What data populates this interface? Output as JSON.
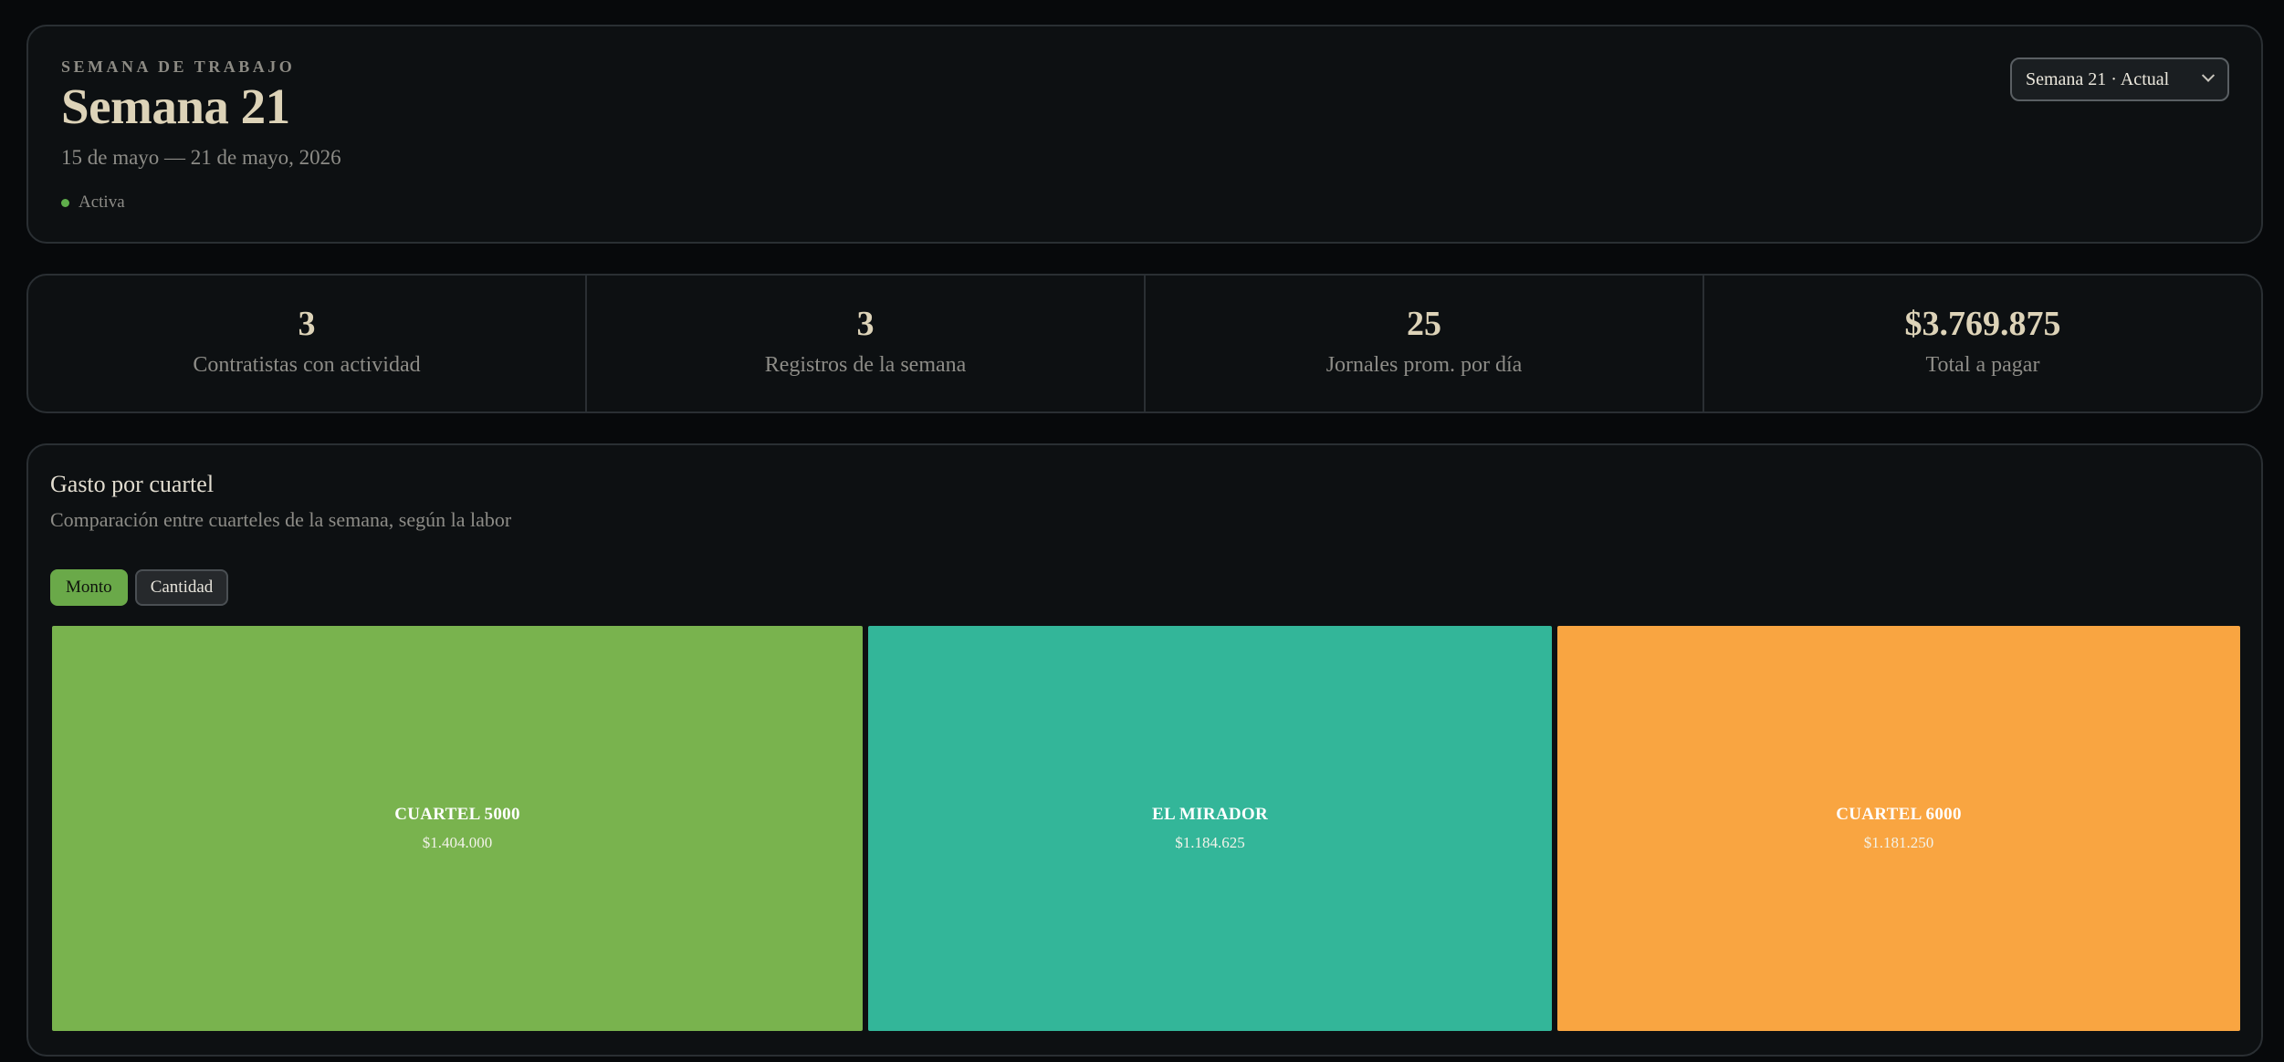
{
  "header": {
    "eyebrow": "SEMANA DE TRABAJO",
    "title": "Semana 21",
    "date_range": "15 de mayo — 21 de mayo, 2026",
    "status": "Activa",
    "status_color": "#5fae4b",
    "week_select": {
      "selected": "Semana 21 · Actual",
      "icon": "chevron-down-icon"
    }
  },
  "stats": [
    {
      "value": "3",
      "label": "Contratistas con actividad"
    },
    {
      "value": "3",
      "label": "Registros de la semana"
    },
    {
      "value": "25",
      "label": "Jornales prom. por día"
    },
    {
      "value": "$3.769.875",
      "label": "Total a pagar"
    }
  ],
  "spend": {
    "title": "Gasto por cuartel",
    "subtitle": "Comparación entre cuarteles de la semana, según la labor",
    "toggles": [
      {
        "label": "Monto",
        "active": true
      },
      {
        "label": "Cantidad",
        "active": false
      }
    ],
    "accent_color": "#6aa949"
  },
  "chart_data": {
    "type": "treemap",
    "categories": [
      "CUARTEL 5000",
      "EL MIRADOR",
      "CUARTEL 6000"
    ],
    "values": [
      1404000,
      1184625,
      1181250
    ],
    "value_labels": [
      "$1.404.000",
      "$1.184.625",
      "$1.181.250"
    ],
    "colors": [
      "#79b34e",
      "#33b699",
      "#f9a541"
    ]
  }
}
